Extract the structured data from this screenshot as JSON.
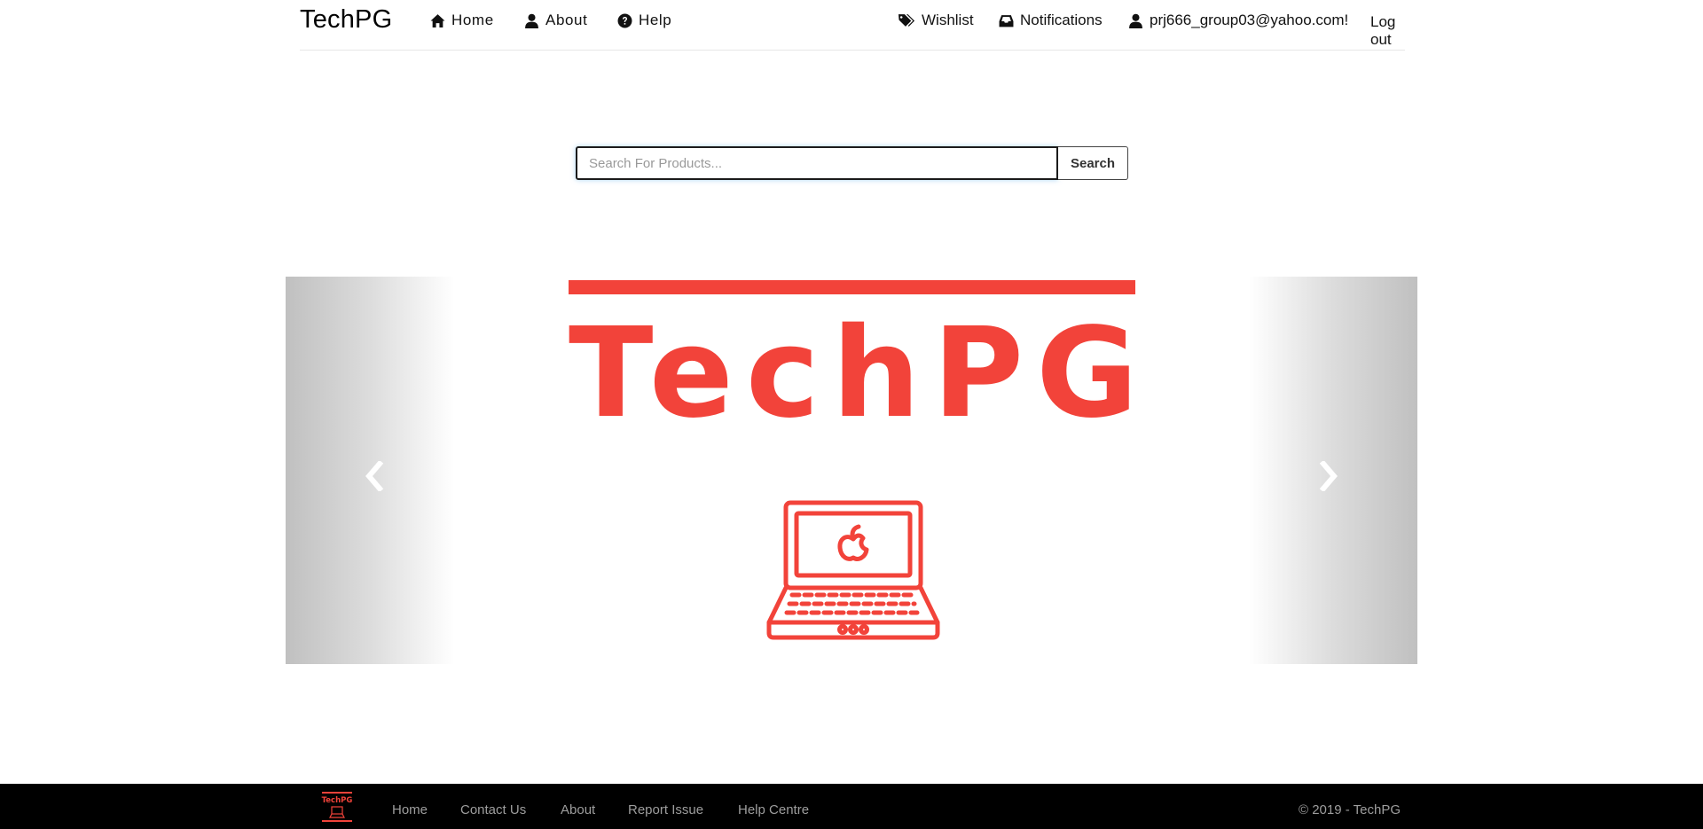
{
  "nav": {
    "brand": "TechPG",
    "home": "Home",
    "about": "About",
    "help": "Help",
    "wishlist": "Wishlist",
    "notifications": "Notifications",
    "user_email": "prj666_group03@yahoo.com!",
    "logout": "Log out"
  },
  "search": {
    "placeholder": "Search For Products...",
    "button_label": "Search"
  },
  "carousel": {
    "slide_title": "TechPG",
    "accent_color": "#f2433a",
    "prev_icon": "chevron-left-icon",
    "next_icon": "chevron-right-icon"
  },
  "footer": {
    "logo_text": "TechPG",
    "links": [
      "Home",
      "Contact Us",
      "About",
      "Report Issue",
      "Help Centre"
    ],
    "copyright": "© 2019 - TechPG"
  }
}
